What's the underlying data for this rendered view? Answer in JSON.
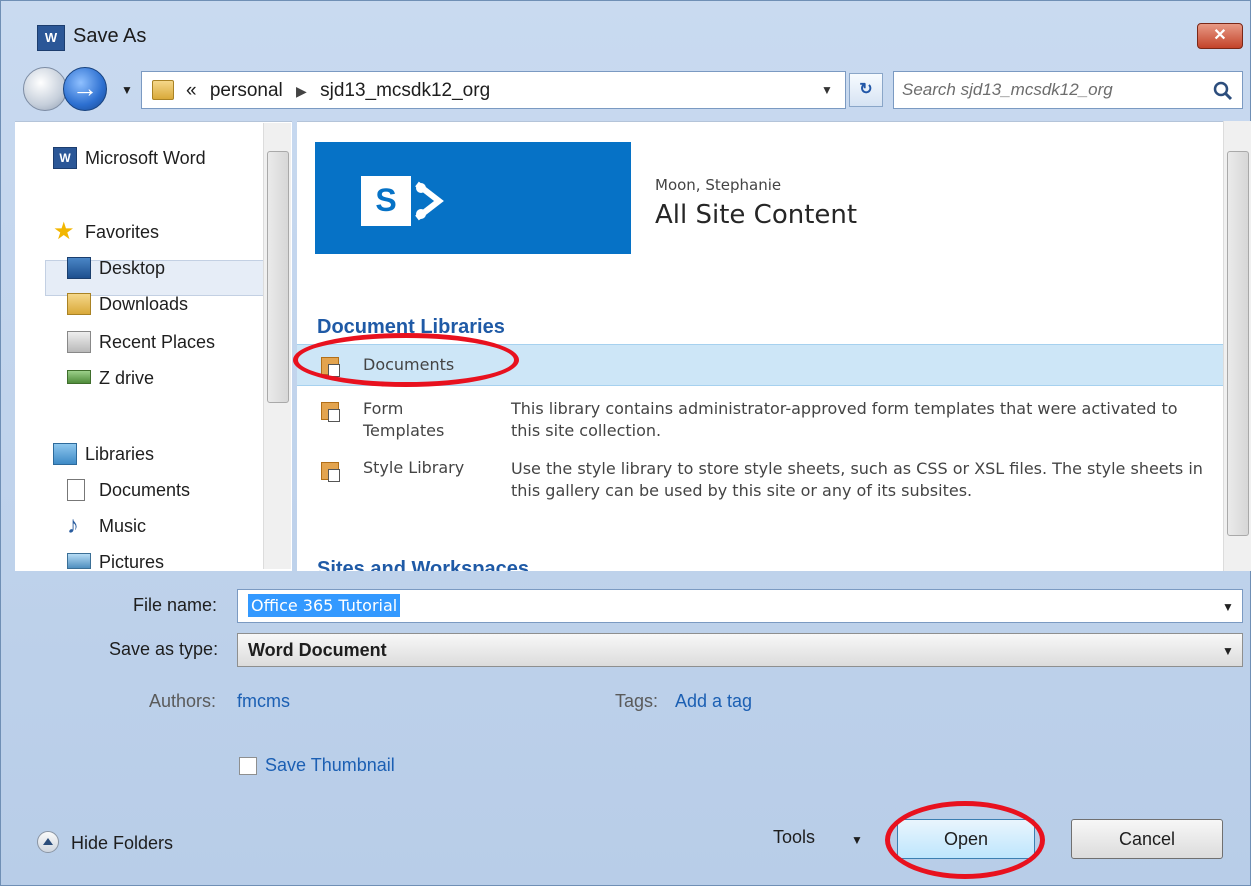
{
  "window": {
    "title": "Save As",
    "app_icon": "word-icon",
    "close_label": "✕"
  },
  "address": {
    "breadcrumbs": [
      "«",
      "personal",
      "sjd13_mcsdk12_org"
    ],
    "search_placeholder": "Search sjd13_mcsdk12_org"
  },
  "nav": {
    "app_item": "Microsoft Word",
    "favorites": {
      "label": "Favorites",
      "items": [
        "Desktop",
        "Downloads",
        "Recent Places",
        "Z drive"
      ]
    },
    "libraries": {
      "label": "Libraries",
      "items": [
        "Documents",
        "Music",
        "Pictures"
      ]
    }
  },
  "content": {
    "site_owner": "Moon, Stephanie",
    "site_title": "All Site Content",
    "logo_letter": "S",
    "section_heading": "Document Libraries",
    "libraries": [
      {
        "name": "Documents",
        "description": ""
      },
      {
        "name": "Form\nTemplates",
        "description": "This library contains administrator-approved form templates that were activated to this site collection."
      },
      {
        "name": "Style Library",
        "description": "Use the style library to store style sheets, such as CSS or XSL files. The style sheets in this gallery can be used by this site or any of its subsites."
      }
    ],
    "next_heading": "Sites and Workspaces"
  },
  "form": {
    "file_name_label": "File name:",
    "file_name_value": "Office 365 Tutorial",
    "save_as_type_label": "Save as type:",
    "save_as_type_value": "Word Document",
    "authors_label": "Authors:",
    "authors_value": "fmcms",
    "tags_label": "Tags:",
    "tags_value": "Add a tag",
    "thumbnail_label": "Save Thumbnail"
  },
  "footer": {
    "hide_folders": "Hide Folders",
    "tools": "Tools",
    "open": "Open",
    "cancel": "Cancel"
  },
  "colors": {
    "annotation": "#e8111e",
    "sharepoint_blue": "#0672c6",
    "link": "#1b5fb3"
  }
}
